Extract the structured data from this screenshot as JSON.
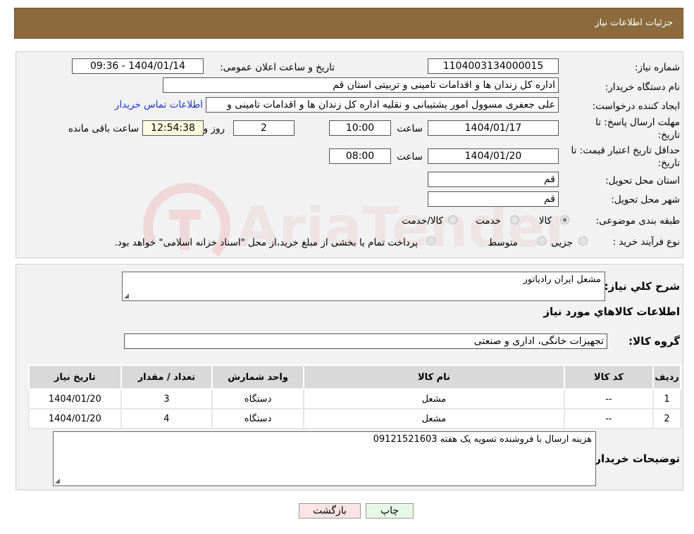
{
  "header": {
    "title": "جزئیات اطلاعات نیاز"
  },
  "form": {
    "need_number_label": "شماره نیاز:",
    "need_number": "1104003134000015",
    "announce_label": "تاریخ و ساعت اعلان عمومی:",
    "announce_value": "1404/01/14 - 09:36",
    "buyer_org_label": "نام دستگاه خریدار:",
    "buyer_org": "اداره کل زندان ها و اقدامات تامینی و تربیتی استان قم",
    "creator_label": "ایجاد کننده درخواست:",
    "creator": "علی جعفری مسوول امور پشتیبانی و نقلیه اداره کل زندان ها و اقدامات تامینی و",
    "contact_link": "اطلاعات تماس خریدار",
    "reply_deadline_label_1": "مهلت ارسال پاسخ: تا",
    "reply_deadline_label_2": "تاریخ:",
    "reply_date": "1404/01/17",
    "time_label": "ساعت",
    "reply_time": "10:00",
    "days": "2",
    "days_label": "روز و",
    "remaining": "12:54:38",
    "remaining_label": "ساعت باقی مانده",
    "price_validity_label_1": "حداقل تاریخ اعتبار قیمت: تا",
    "price_validity_label_2": "تاریخ:",
    "price_date": "1404/01/20",
    "price_time": "08:00",
    "province_label": "استان محل تحویل:",
    "province": "قم",
    "city_label": "شهر محل تحویل:",
    "city": "قم",
    "category_label": "طبقه بندی موضوعی:",
    "category_options": [
      "کالا",
      "خدمت",
      "کالا/خدمت"
    ],
    "process_label": "نوع فرآیند خرید :",
    "process_options": [
      "جزیی",
      "متوسط"
    ],
    "process_note": "پرداخت تمام یا بخشی از مبلغ خرید،از محل \"اسناد خزانه اسلامی\" خواهد بود."
  },
  "summary": {
    "desc_label": "شرح کلي نياز:",
    "desc": "مشعل ایران رادیاتور",
    "goods_info_title": "اطلاعات کالاهاي مورد نياز",
    "group_label": "گروه کالا:",
    "group": "تجهیزات خانگی، اداری و صنعتی"
  },
  "table": {
    "headers": [
      "رديف",
      "کد کالا",
      "نام کالا",
      "واحد شمارش",
      "تعداد / مقدار",
      "تاریخ نیاز"
    ],
    "rows": [
      [
        "1",
        "--",
        "مشعل",
        "دستگاه",
        "3",
        "1404/01/20"
      ],
      [
        "2",
        "--",
        "مشعل",
        "دستگاه",
        "4",
        "1404/01/20"
      ]
    ]
  },
  "notes": {
    "label": "توضيحات خريدار:",
    "text": "هزینه ارسال با فروشنده تسویه یک هفته 09121521603"
  },
  "buttons": {
    "print": "چاپ",
    "back": "بازگشت"
  },
  "colors": {
    "header_bg": "#8b6b3d",
    "link": "#1a38c8",
    "back_button_bg": "#fde4e4",
    "print_button_bg": "#e8f8e8"
  }
}
